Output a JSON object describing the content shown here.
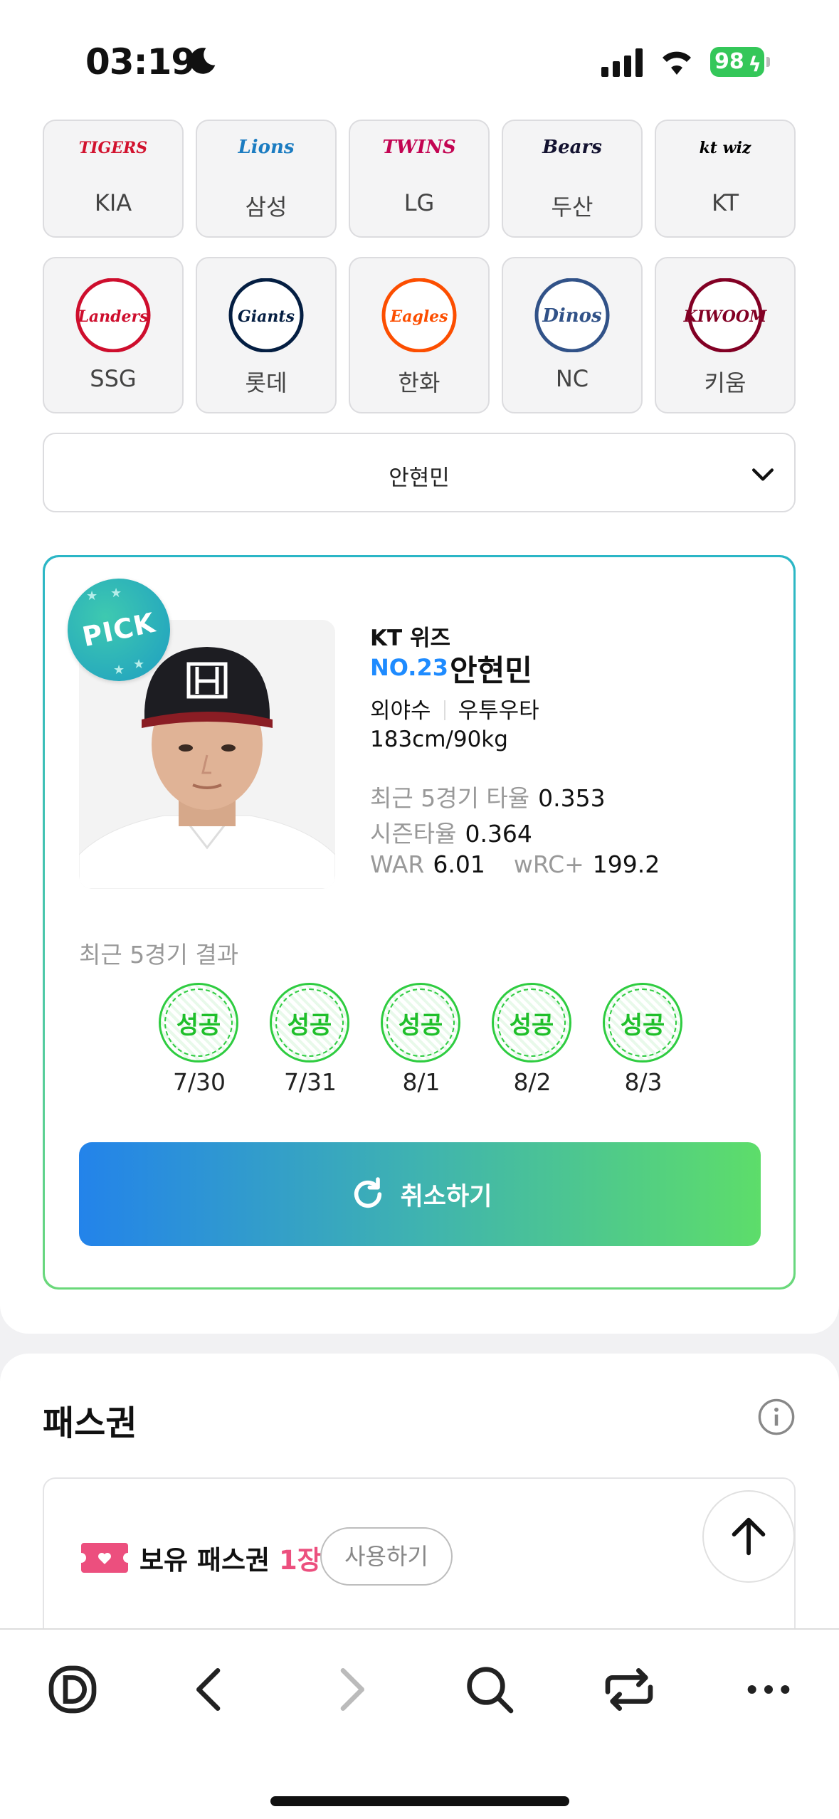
{
  "status_bar": {
    "time": "03:19",
    "battery": "98"
  },
  "teams": [
    {
      "name": "KIA",
      "logo": "TIGERS",
      "icon": "kia-tigers-logo",
      "color": "#d2122e"
    },
    {
      "name": "삼성",
      "logo": "Lions",
      "icon": "samsung-lions-logo",
      "color": "#1b7cc1"
    },
    {
      "name": "LG",
      "logo": "TWINS",
      "icon": "lg-twins-logo",
      "color": "#c30452"
    },
    {
      "name": "두산",
      "logo": "Bears",
      "icon": "doosan-bears-logo",
      "color": "#131230"
    },
    {
      "name": "KT",
      "logo": "kt wiz",
      "icon": "kt-wiz-logo",
      "color": "#000000"
    },
    {
      "name": "SSG",
      "logo": "Landers",
      "icon": "ssg-landers-logo",
      "color": "#ce0e2d"
    },
    {
      "name": "롯데",
      "logo": "Giants",
      "icon": "lotte-giants-logo",
      "color": "#041e42"
    },
    {
      "name": "한화",
      "logo": "Eagles",
      "icon": "hanwha-eagles-logo",
      "color": "#fc4e00"
    },
    {
      "name": "NC",
      "logo": "Dinos",
      "icon": "nc-dinos-logo",
      "color": "#315288"
    },
    {
      "name": "키움",
      "logo": "KIWOOM",
      "icon": "kiwoom-heroes-logo",
      "color": "#820024"
    }
  ],
  "player_select": {
    "value": "안현민"
  },
  "player": {
    "badge": "PICK",
    "team": "KT 위즈",
    "number": "NO.23",
    "name": "안현민",
    "position": "외야수",
    "bats_throws": "우투우타",
    "body": "183cm/90kg",
    "recent5_avg_label": "최근 5경기 타율",
    "recent5_avg": "0.353",
    "season_avg_label": "시즌타율",
    "season_avg": "0.364",
    "war_label": "WAR",
    "war": "6.01",
    "wrc_label": "wRC+",
    "wrc": "199.2"
  },
  "recent_results": {
    "title": "최근 5경기 결과",
    "games": [
      {
        "result": "성공",
        "date": "7/30"
      },
      {
        "result": "성공",
        "date": "7/31"
      },
      {
        "result": "성공",
        "date": "8/1"
      },
      {
        "result": "성공",
        "date": "8/2"
      },
      {
        "result": "성공",
        "date": "8/3"
      }
    ]
  },
  "cancel_button": {
    "label": "취소하기"
  },
  "pass": {
    "title": "패스권",
    "owned_label": "보유 패스권",
    "owned_count": "1장",
    "use_button": "사용하기"
  },
  "colors": {
    "accent_blue": "#1e8bff",
    "success_green": "#2ecc40",
    "pink": "#ec4f7e"
  }
}
